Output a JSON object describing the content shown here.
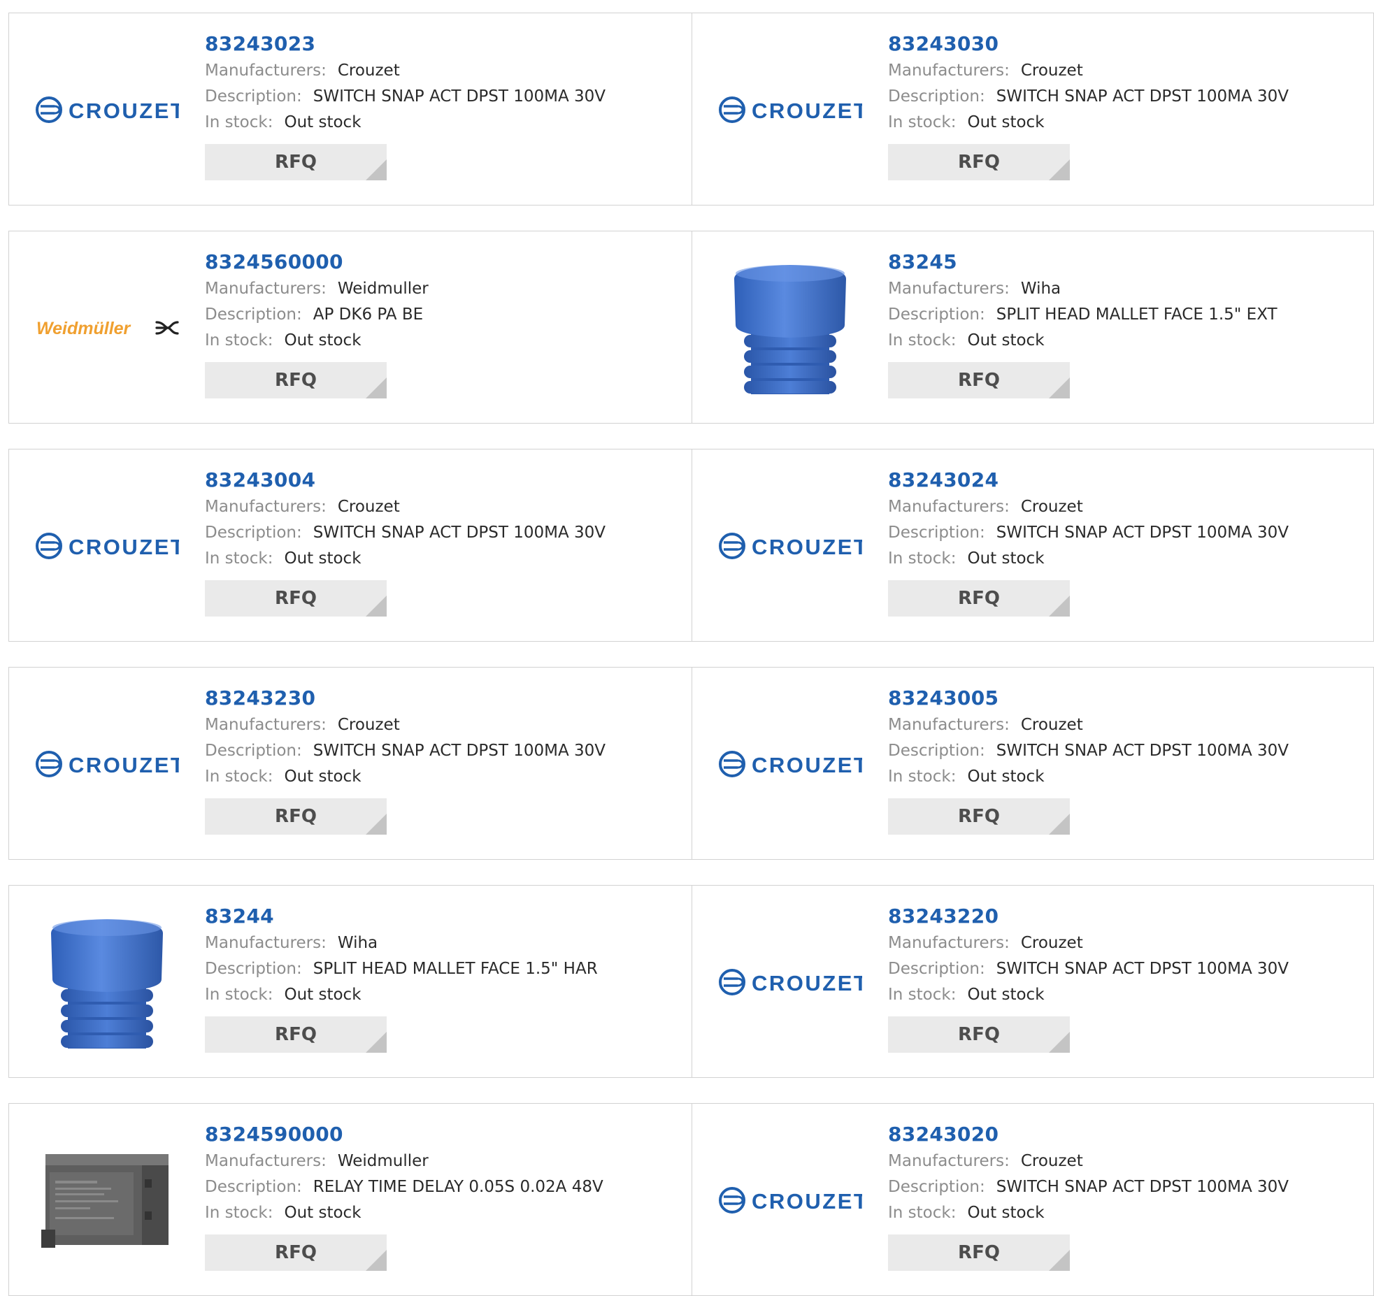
{
  "labels": {
    "manufacturers": "Manufacturers:",
    "description": "Description:",
    "in_stock": "In stock:",
    "rfq": "RFQ"
  },
  "brand_logos": {
    "crouzet": {
      "text": "CROUZET",
      "color": "#1f5fae"
    },
    "weidmuller": {
      "text": "Weidmüller",
      "color": "#f0a030"
    }
  },
  "products": [
    {
      "pn": "83243023",
      "manufacturer": "Crouzet",
      "description": "SWITCH SNAP ACT DPST 100MA 30V",
      "stock": "Out stock",
      "image": "crouzet-logo"
    },
    {
      "pn": "83243030",
      "manufacturer": "Crouzet",
      "description": "SWITCH SNAP ACT DPST 100MA 30V",
      "stock": "Out stock",
      "image": "crouzet-logo"
    },
    {
      "pn": "8324560000",
      "manufacturer": "Weidmuller",
      "description": "AP DK6 PA BE",
      "stock": "Out stock",
      "image": "weidmuller-logo"
    },
    {
      "pn": "83245",
      "manufacturer": "Wiha",
      "description": "SPLIT HEAD MALLET FACE 1.5\" EXT",
      "stock": "Out stock",
      "image": "mallet-face"
    },
    {
      "pn": "83243004",
      "manufacturer": "Crouzet",
      "description": "SWITCH SNAP ACT DPST 100MA 30V",
      "stock": "Out stock",
      "image": "crouzet-logo"
    },
    {
      "pn": "83243024",
      "manufacturer": "Crouzet",
      "description": "SWITCH SNAP ACT DPST 100MA 30V",
      "stock": "Out stock",
      "image": "crouzet-logo"
    },
    {
      "pn": "83243230",
      "manufacturer": "Crouzet",
      "description": "SWITCH SNAP ACT DPST 100MA 30V",
      "stock": "Out stock",
      "image": "crouzet-logo"
    },
    {
      "pn": "83243005",
      "manufacturer": "Crouzet",
      "description": "SWITCH SNAP ACT DPST 100MA 30V",
      "stock": "Out stock",
      "image": "crouzet-logo"
    },
    {
      "pn": "83244",
      "manufacturer": "Wiha",
      "description": "SPLIT HEAD MALLET FACE 1.5\" HAR",
      "stock": "Out stock",
      "image": "mallet-face"
    },
    {
      "pn": "83243220",
      "manufacturer": "Crouzet",
      "description": "SWITCH SNAP ACT DPST 100MA 30V",
      "stock": "Out stock",
      "image": "crouzet-logo"
    },
    {
      "pn": "8324590000",
      "manufacturer": "Weidmuller",
      "description": "RELAY TIME DELAY 0.05S 0.02A 48V",
      "stock": "Out stock",
      "image": "relay-module"
    },
    {
      "pn": "83243020",
      "manufacturer": "Crouzet",
      "description": "SWITCH SNAP ACT DPST 100MA 30V",
      "stock": "Out stock",
      "image": "crouzet-logo"
    }
  ]
}
